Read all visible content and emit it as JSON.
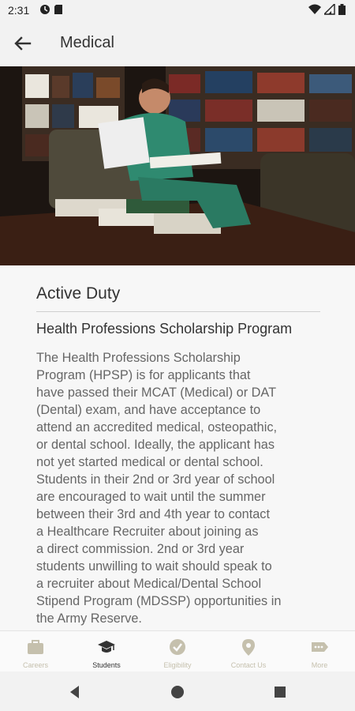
{
  "status_bar": {
    "time": "2:31",
    "icons": [
      "data-saver-icon",
      "sd-card-icon",
      "wifi-icon",
      "signal-icon",
      "battery-icon"
    ]
  },
  "app_bar": {
    "title": "Medical",
    "back_icon": "arrow-back-icon"
  },
  "hero": {
    "image": "photo-of-medical-student-studying-in-library",
    "colors": {
      "dark": "#1a1410",
      "scrubs": "#2f8a70",
      "wood": "#3a1f14"
    }
  },
  "content": {
    "section_title": "Active Duty",
    "program_title": "Health Professions Scholarship Program",
    "body_lines": [
      "The Health Professions Scholarship",
      "Program (HPSP) is for applicants that",
      "have passed their MCAT (Medical) or DAT",
      "(Dental) exam, and have acceptance to",
      "attend an accredited medical, osteopathic,",
      "or dental school. Ideally, the applicant has",
      "not yet started medical or dental school.",
      "Students in their 2nd or 3rd year of school",
      "are encouraged to wait until the summer",
      "between their 3rd and 4th year to contact",
      "a Healthcare Recruiter about joining as",
      "a direct commission. 2nd or 3rd year",
      "students unwilling to wait should speak to",
      "a recruiter about Medical/Dental School",
      "Stipend Program (MDSSP) opportunities in",
      "the Army Reserve."
    ]
  },
  "bottom_nav": {
    "active_color": "#333333",
    "inactive_color": "#c5c0ad",
    "items": [
      {
        "label": "Careers",
        "icon": "briefcase-icon",
        "active": false
      },
      {
        "label": "Students",
        "icon": "graduation-cap-icon",
        "active": true
      },
      {
        "label": "Eligibility",
        "icon": "check-badge-icon",
        "active": false
      },
      {
        "label": "Contact Us",
        "icon": "location-pin-icon",
        "active": false
      },
      {
        "label": "More",
        "icon": "more-tag-icon",
        "active": false
      }
    ]
  },
  "system_nav": {
    "buttons": [
      "back-triangle-icon",
      "home-circle-icon",
      "recents-square-icon"
    ]
  }
}
